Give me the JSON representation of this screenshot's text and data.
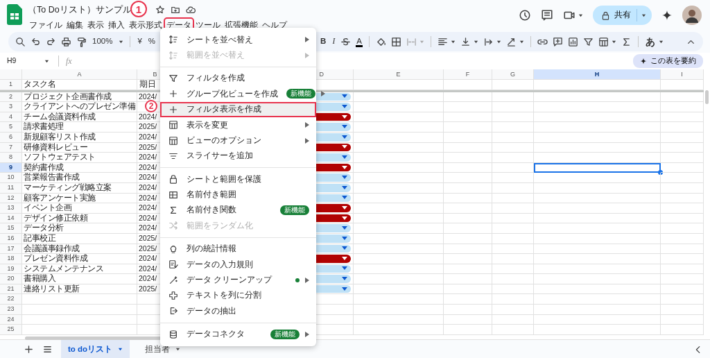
{
  "app": {
    "title": "（To Doリスト）サンプル"
  },
  "menubar": [
    {
      "label": "ファイル",
      "marked": false
    },
    {
      "label": "編集",
      "marked": false
    },
    {
      "label": "表示",
      "marked": false
    },
    {
      "label": "挿入",
      "marked": false
    },
    {
      "label": "表示形式",
      "marked": false
    },
    {
      "label": "データ",
      "marked": true
    },
    {
      "label": "ツール",
      "marked": false
    },
    {
      "label": "拡張機能",
      "marked": false
    },
    {
      "label": "ヘルプ",
      "marked": false
    }
  ],
  "share_button": {
    "label": "共有"
  },
  "toolbar": {
    "zoom": "100%",
    "currency": "¥",
    "percent": "%",
    "bold": "B",
    "italic": "I",
    "text_color": "A",
    "input_tool": "あ"
  },
  "formula_bar": {
    "cell_ref": "H9",
    "fx": "fx",
    "summarize_button": "この表を要約"
  },
  "grid": {
    "columns": [
      {
        "label": "A",
        "selected": false
      },
      {
        "label": "B",
        "selected": false
      },
      {
        "label": "D",
        "selected": false
      },
      {
        "label": "E",
        "selected": false
      },
      {
        "label": "F",
        "selected": false
      },
      {
        "label": "G",
        "selected": false
      },
      {
        "label": "H",
        "selected": true
      },
      {
        "label": "I",
        "selected": false
      }
    ],
    "rows": [
      {
        "number": "1",
        "selected": false,
        "task": "タスク名",
        "due": "期日"
      },
      {
        "number": "2",
        "selected": false,
        "task": "プロジェクト企画書作成",
        "due": "2024/",
        "color": "#bfe1f6"
      },
      {
        "number": "3",
        "selected": false,
        "task": "クライアントへのプレゼン準備",
        "color": "#bfe1f6"
      },
      {
        "number": "4",
        "selected": false,
        "task": "チーム会議資料作成",
        "due": "2024/",
        "color": "#b10202"
      },
      {
        "number": "5",
        "selected": false,
        "task": "請求書処理",
        "due": "2025/",
        "color": "#bfe1f6"
      },
      {
        "number": "6",
        "selected": false,
        "task": "新規顧客リスト作成",
        "due": "2024/",
        "color": "#bfe1f6"
      },
      {
        "number": "7",
        "selected": false,
        "task": "研修資料レビュー",
        "due": "2025/",
        "color": "#b10202"
      },
      {
        "number": "8",
        "selected": false,
        "task": "ソフトウェアテスト",
        "due": "2024/",
        "color": "#bfe1f6"
      },
      {
        "number": "9",
        "selected": true,
        "task": "契約書作成",
        "due": "2024/",
        "color": "#b10202"
      },
      {
        "number": "10",
        "selected": false,
        "task": "営業報告書作成",
        "due": "2024/",
        "color": "#bfe1f6"
      },
      {
        "number": "11",
        "selected": false,
        "task": "マーケティング戦略立案",
        "due": "2024/",
        "color": "#bfe1f6"
      },
      {
        "number": "12",
        "selected": false,
        "task": "顧客アンケート実施",
        "due": "2024/",
        "color": "#bfe1f6"
      },
      {
        "number": "13",
        "selected": false,
        "task": "イベント企画",
        "due": "2024/",
        "color": "#b10202"
      },
      {
        "number": "14",
        "selected": false,
        "task": "デザイン修正依頼",
        "due": "2024/",
        "color": "#b10202"
      },
      {
        "number": "15",
        "selected": false,
        "task": "データ分析",
        "due": "2024/",
        "color": "#bfe1f6"
      },
      {
        "number": "16",
        "selected": false,
        "task": "記事校正",
        "due": "2025/",
        "color": "#bfe1f6"
      },
      {
        "number": "17",
        "selected": false,
        "task": "会議議事録作成",
        "due": "2025/",
        "color": "#bfe1f6"
      },
      {
        "number": "18",
        "selected": false,
        "task": "プレゼン資料作成",
        "due": "2024/",
        "color": "#b10202"
      },
      {
        "number": "19",
        "selected": false,
        "task": "システムメンテナンス",
        "due": "2024/",
        "color": "#bfe1f6"
      },
      {
        "number": "20",
        "selected": false,
        "task": "書籍購入",
        "due": "2024/",
        "color": "#bfe1f6"
      },
      {
        "number": "21",
        "selected": false,
        "task": "連絡リスト更新",
        "due": "2025/",
        "color": "#bfe1f6"
      },
      {
        "number": "22",
        "selected": false
      },
      {
        "number": "23",
        "selected": false
      },
      {
        "number": "24",
        "selected": false
      },
      {
        "number": "25",
        "selected": false
      }
    ]
  },
  "data_menu": {
    "items": [
      {
        "kind": "item",
        "label": "シートを並べ替え",
        "disabled": false,
        "submenu": true,
        "marked": false
      },
      {
        "kind": "item",
        "label": "範囲を並べ替え",
        "disabled": true,
        "submenu": true,
        "marked": false
      },
      {
        "kind": "divider"
      },
      {
        "kind": "item",
        "label": "フィルタを作成",
        "disabled": false,
        "submenu": false,
        "marked": false
      },
      {
        "kind": "item",
        "label": "グループ化ビューを作成",
        "disabled": false,
        "submenu": true,
        "marked": false,
        "badge": "新機能"
      },
      {
        "kind": "item",
        "label": "フィルタ表示を作成",
        "disabled": false,
        "submenu": false,
        "marked": true
      },
      {
        "kind": "item",
        "label": "表示を変更",
        "disabled": false,
        "submenu": true,
        "marked": false
      },
      {
        "kind": "item",
        "label": "ビューのオプション",
        "disabled": false,
        "submenu": true,
        "marked": false
      },
      {
        "kind": "item",
        "label": "スライサーを追加",
        "disabled": false,
        "submenu": false,
        "marked": false
      },
      {
        "kind": "divider"
      },
      {
        "kind": "item",
        "label": "シートと範囲を保護",
        "disabled": false,
        "submenu": false,
        "marked": false
      },
      {
        "kind": "item",
        "label": "名前付き範囲",
        "disabled": false,
        "submenu": false,
        "marked": false
      },
      {
        "kind": "item",
        "label": "名前付き関数",
        "disabled": false,
        "submenu": false,
        "marked": false,
        "badge": "新機能"
      },
      {
        "kind": "item",
        "label": "範囲をランダム化",
        "disabled": true,
        "submenu": false,
        "marked": false
      },
      {
        "kind": "divider"
      },
      {
        "kind": "item",
        "label": "列の統計情報",
        "disabled": false,
        "submenu": false,
        "marked": false
      },
      {
        "kind": "item",
        "label": "データの入力規則",
        "disabled": false,
        "submenu": false,
        "marked": false
      },
      {
        "kind": "item",
        "label": "データ クリーンアップ",
        "disabled": false,
        "submenu": true,
        "marked": false,
        "dot": true
      },
      {
        "kind": "item",
        "label": "テキストを列に分割",
        "disabled": false,
        "submenu": false,
        "marked": false
      },
      {
        "kind": "item",
        "label": "データの抽出",
        "disabled": false,
        "submenu": false,
        "marked": false
      },
      {
        "kind": "divider"
      },
      {
        "kind": "item",
        "label": "データコネクタ",
        "disabled": false,
        "submenu": true,
        "marked": false,
        "badge": "新機能"
      }
    ]
  },
  "annotations": [
    {
      "label": "1"
    },
    {
      "label": "2"
    }
  ],
  "sheet_tabs": [
    {
      "label": "to doリスト",
      "selected": true
    },
    {
      "label": "担当者",
      "selected": false
    }
  ]
}
